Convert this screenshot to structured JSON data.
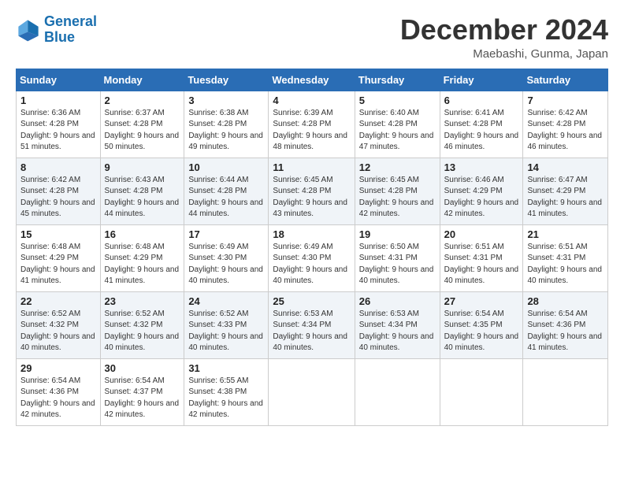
{
  "logo": {
    "line1": "General",
    "line2": "Blue"
  },
  "title": "December 2024",
  "subtitle": "Maebashi, Gunma, Japan",
  "days_of_week": [
    "Sunday",
    "Monday",
    "Tuesday",
    "Wednesday",
    "Thursday",
    "Friday",
    "Saturday"
  ],
  "weeks": [
    [
      {
        "day": "1",
        "sunrise": "6:36 AM",
        "sunset": "4:28 PM",
        "daylight": "9 hours and 51 minutes."
      },
      {
        "day": "2",
        "sunrise": "6:37 AM",
        "sunset": "4:28 PM",
        "daylight": "9 hours and 50 minutes."
      },
      {
        "day": "3",
        "sunrise": "6:38 AM",
        "sunset": "4:28 PM",
        "daylight": "9 hours and 49 minutes."
      },
      {
        "day": "4",
        "sunrise": "6:39 AM",
        "sunset": "4:28 PM",
        "daylight": "9 hours and 48 minutes."
      },
      {
        "day": "5",
        "sunrise": "6:40 AM",
        "sunset": "4:28 PM",
        "daylight": "9 hours and 47 minutes."
      },
      {
        "day": "6",
        "sunrise": "6:41 AM",
        "sunset": "4:28 PM",
        "daylight": "9 hours and 46 minutes."
      },
      {
        "day": "7",
        "sunrise": "6:42 AM",
        "sunset": "4:28 PM",
        "daylight": "9 hours and 46 minutes."
      }
    ],
    [
      {
        "day": "8",
        "sunrise": "6:42 AM",
        "sunset": "4:28 PM",
        "daylight": "9 hours and 45 minutes."
      },
      {
        "day": "9",
        "sunrise": "6:43 AM",
        "sunset": "4:28 PM",
        "daylight": "9 hours and 44 minutes."
      },
      {
        "day": "10",
        "sunrise": "6:44 AM",
        "sunset": "4:28 PM",
        "daylight": "9 hours and 44 minutes."
      },
      {
        "day": "11",
        "sunrise": "6:45 AM",
        "sunset": "4:28 PM",
        "daylight": "9 hours and 43 minutes."
      },
      {
        "day": "12",
        "sunrise": "6:45 AM",
        "sunset": "4:28 PM",
        "daylight": "9 hours and 42 minutes."
      },
      {
        "day": "13",
        "sunrise": "6:46 AM",
        "sunset": "4:29 PM",
        "daylight": "9 hours and 42 minutes."
      },
      {
        "day": "14",
        "sunrise": "6:47 AM",
        "sunset": "4:29 PM",
        "daylight": "9 hours and 41 minutes."
      }
    ],
    [
      {
        "day": "15",
        "sunrise": "6:48 AM",
        "sunset": "4:29 PM",
        "daylight": "9 hours and 41 minutes."
      },
      {
        "day": "16",
        "sunrise": "6:48 AM",
        "sunset": "4:29 PM",
        "daylight": "9 hours and 41 minutes."
      },
      {
        "day": "17",
        "sunrise": "6:49 AM",
        "sunset": "4:30 PM",
        "daylight": "9 hours and 40 minutes."
      },
      {
        "day": "18",
        "sunrise": "6:49 AM",
        "sunset": "4:30 PM",
        "daylight": "9 hours and 40 minutes."
      },
      {
        "day": "19",
        "sunrise": "6:50 AM",
        "sunset": "4:31 PM",
        "daylight": "9 hours and 40 minutes."
      },
      {
        "day": "20",
        "sunrise": "6:51 AM",
        "sunset": "4:31 PM",
        "daylight": "9 hours and 40 minutes."
      },
      {
        "day": "21",
        "sunrise": "6:51 AM",
        "sunset": "4:31 PM",
        "daylight": "9 hours and 40 minutes."
      }
    ],
    [
      {
        "day": "22",
        "sunrise": "6:52 AM",
        "sunset": "4:32 PM",
        "daylight": "9 hours and 40 minutes."
      },
      {
        "day": "23",
        "sunrise": "6:52 AM",
        "sunset": "4:32 PM",
        "daylight": "9 hours and 40 minutes."
      },
      {
        "day": "24",
        "sunrise": "6:52 AM",
        "sunset": "4:33 PM",
        "daylight": "9 hours and 40 minutes."
      },
      {
        "day": "25",
        "sunrise": "6:53 AM",
        "sunset": "4:34 PM",
        "daylight": "9 hours and 40 minutes."
      },
      {
        "day": "26",
        "sunrise": "6:53 AM",
        "sunset": "4:34 PM",
        "daylight": "9 hours and 40 minutes."
      },
      {
        "day": "27",
        "sunrise": "6:54 AM",
        "sunset": "4:35 PM",
        "daylight": "9 hours and 40 minutes."
      },
      {
        "day": "28",
        "sunrise": "6:54 AM",
        "sunset": "4:36 PM",
        "daylight": "9 hours and 41 minutes."
      }
    ],
    [
      {
        "day": "29",
        "sunrise": "6:54 AM",
        "sunset": "4:36 PM",
        "daylight": "9 hours and 42 minutes."
      },
      {
        "day": "30",
        "sunrise": "6:54 AM",
        "sunset": "4:37 PM",
        "daylight": "9 hours and 42 minutes."
      },
      {
        "day": "31",
        "sunrise": "6:55 AM",
        "sunset": "4:38 PM",
        "daylight": "9 hours and 42 minutes."
      },
      null,
      null,
      null,
      null
    ]
  ]
}
